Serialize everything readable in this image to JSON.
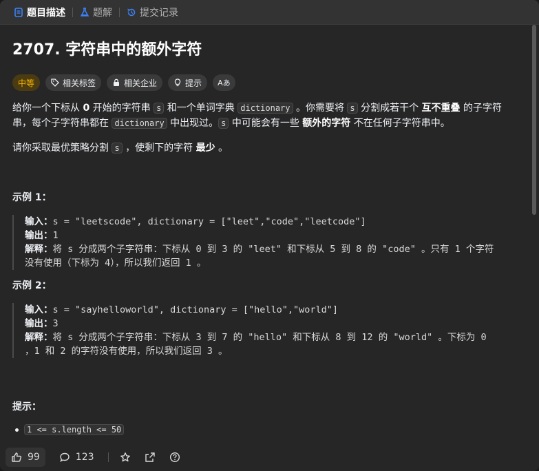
{
  "tabs": [
    {
      "label": "题目描述"
    },
    {
      "label": "题解"
    },
    {
      "label": "提交记录"
    }
  ],
  "problem": {
    "title": "2707. 字符串中的额外字符",
    "difficulty": "中等",
    "tags": [
      "相关标签",
      "相关企业",
      "提示"
    ],
    "lang_icon": "Aあ",
    "desc": {
      "p1a": "给你一个下标从 ",
      "p1b": "0",
      "p1c": " 开始的字符串 ",
      "p1d": "s",
      "p1e": " 和一个单词字典 ",
      "p1f": "dictionary",
      "p1g": " 。你需要将 ",
      "p1h": "s",
      "p1i": " 分割成若干个 ",
      "p1j": "互不重叠",
      "p1k": " 的子字符串，每个子字符串都在 ",
      "p1l": "dictionary",
      "p1m": " 中出现过。",
      "p1n": "s",
      "p1o": " 中可能会有一些 ",
      "p1p": "额外的字符",
      "p1q": " 不在任何子字符串中。",
      "p2a": "请你采取最优策略分割 ",
      "p2b": "s",
      "p2c": " ，使剩下的字符 ",
      "p2d": "最少",
      "p2e": " 。"
    },
    "examples": [
      {
        "heading": "示例 1：",
        "input_label": "输入：",
        "input": "s = \"leetscode\", dictionary = [\"leet\",\"code\",\"leetcode\"]",
        "output_label": "输出：",
        "output": "1",
        "explain_label": "解释：",
        "explain_line1": "将 s 分成两个子字符串：下标从 0 到 3 的 \"leet\" 和下标从 5 到 8 的 \"code\" 。只有 1 个字符",
        "explain_line2": "没有使用（下标为 4），所以我们返回 1 。"
      },
      {
        "heading": "示例 2：",
        "input_label": "输入：",
        "input": "s = \"sayhelloworld\", dictionary = [\"hello\",\"world\"]",
        "output_label": "输出：",
        "output": "3",
        "explain_label": "解释：",
        "explain_line1": "将 s 分成两个子字符串：下标从 3 到 7 的 \"hello\" 和下标从 8 到 12 的 \"world\" 。下标为 0",
        "explain_line2": "，1 和 2 的字符没有使用，所以我们返回 3 。"
      }
    ],
    "hints_heading": "提示：",
    "hint1": "1 <= s.length <= 50"
  },
  "bottom": {
    "likes": "99",
    "comments": "123"
  },
  "colors": {
    "medium": "#ffb800",
    "bg": "#262626",
    "tabbar": "#333333"
  }
}
